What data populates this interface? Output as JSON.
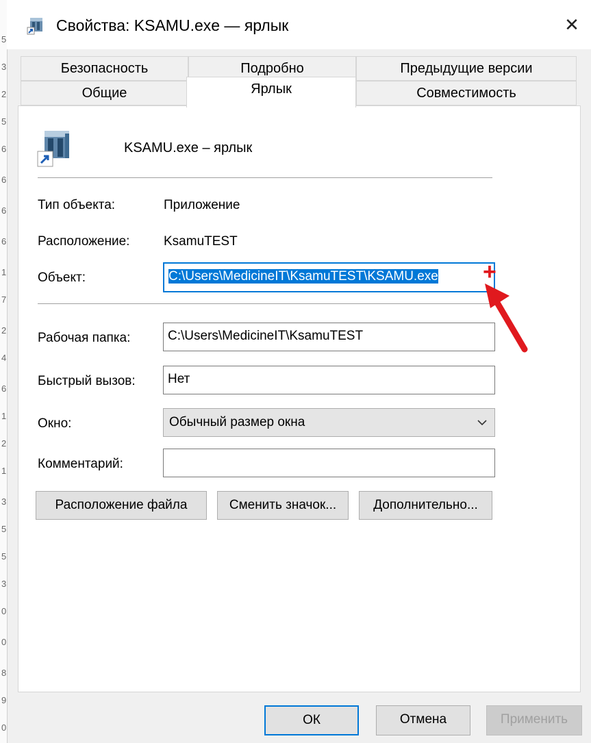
{
  "window": {
    "title": "Свойства: KSAMU.exe — ярлык",
    "close_label": "✕"
  },
  "left_strip_digits": [
    "5",
    "3",
    "2",
    "5",
    "6",
    "6",
    "6",
    "6",
    "1",
    "7",
    "2",
    "4",
    "6",
    "1",
    "2",
    "1",
    "3",
    "5",
    "5",
    "3",
    "0",
    "0",
    "8",
    "9",
    "0"
  ],
  "tabs": {
    "row_back": [
      "Безопасность",
      "Подробно",
      "Предыдущие версии"
    ],
    "row_front": [
      "Общие",
      "Ярлык",
      "Совместимость"
    ],
    "active": "Ярлык"
  },
  "shortcut": {
    "name": "KSAMU.exe – ярлык",
    "icon": "application-shortcut-icon"
  },
  "fields": {
    "type_label": "Тип объекта:",
    "type_value": "Приложение",
    "location_label": "Расположение:",
    "location_value": "KsamuTEST",
    "target_label": "Объект:",
    "target_value": "C:\\Users\\MedicineIT\\KsamuTEST\\KSAMU.exe",
    "workdir_label": "Рабочая папка:",
    "workdir_value": "C:\\Users\\MedicineIT\\KsamuTEST",
    "hotkey_label": "Быстрый вызов:",
    "hotkey_value": "Нет",
    "window_label": "Окно:",
    "window_value": "Обычный размер окна",
    "comment_label": "Комментарий:",
    "comment_value": ""
  },
  "buttons": {
    "file_location": "Расположение файла",
    "change_icon": "Сменить значок...",
    "advanced": "Дополнительно...",
    "ok": "ОК",
    "cancel": "Отмена",
    "apply": "Применить"
  },
  "annotation": {
    "arrow_color": "#e0191e",
    "plus_symbol": "+"
  }
}
